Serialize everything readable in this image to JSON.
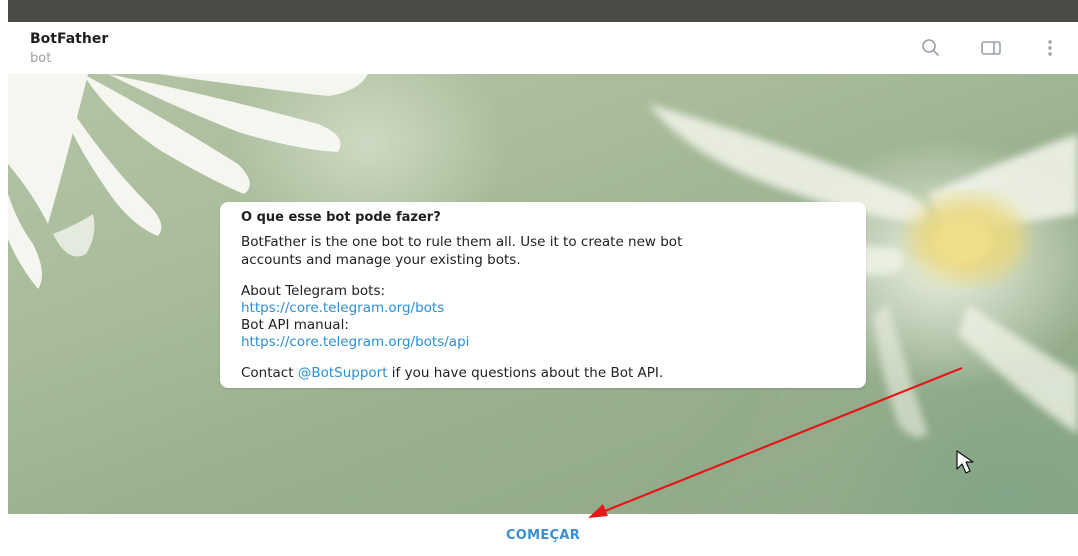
{
  "header": {
    "title": "BotFather",
    "subtitle": "bot",
    "icons": [
      "search-icon",
      "sidebar-panel-icon",
      "more-vertical-icon"
    ]
  },
  "bubble": {
    "title": "O que esse bot pode fazer?",
    "description_line1": "BotFather is the one bot to rule them all. Use it to create new bot",
    "description_line2": "accounts and manage your existing bots.",
    "about_label": "About Telegram bots:",
    "about_link": "https://core.telegram.org/bots",
    "manual_label": "Bot API manual:",
    "manual_link": "https://core.telegram.org/bots/api",
    "contact_prefix": "Contact ",
    "contact_mention": "@BotSupport",
    "contact_suffix": " if you have questions about the Bot API."
  },
  "footer": {
    "start_label": "COMEÇAR"
  },
  "colors": {
    "link": "#2b8fd6",
    "accent": "#3a8fd1",
    "topbar": "#4b4a45",
    "annotation_arrow": "#e3191b"
  }
}
